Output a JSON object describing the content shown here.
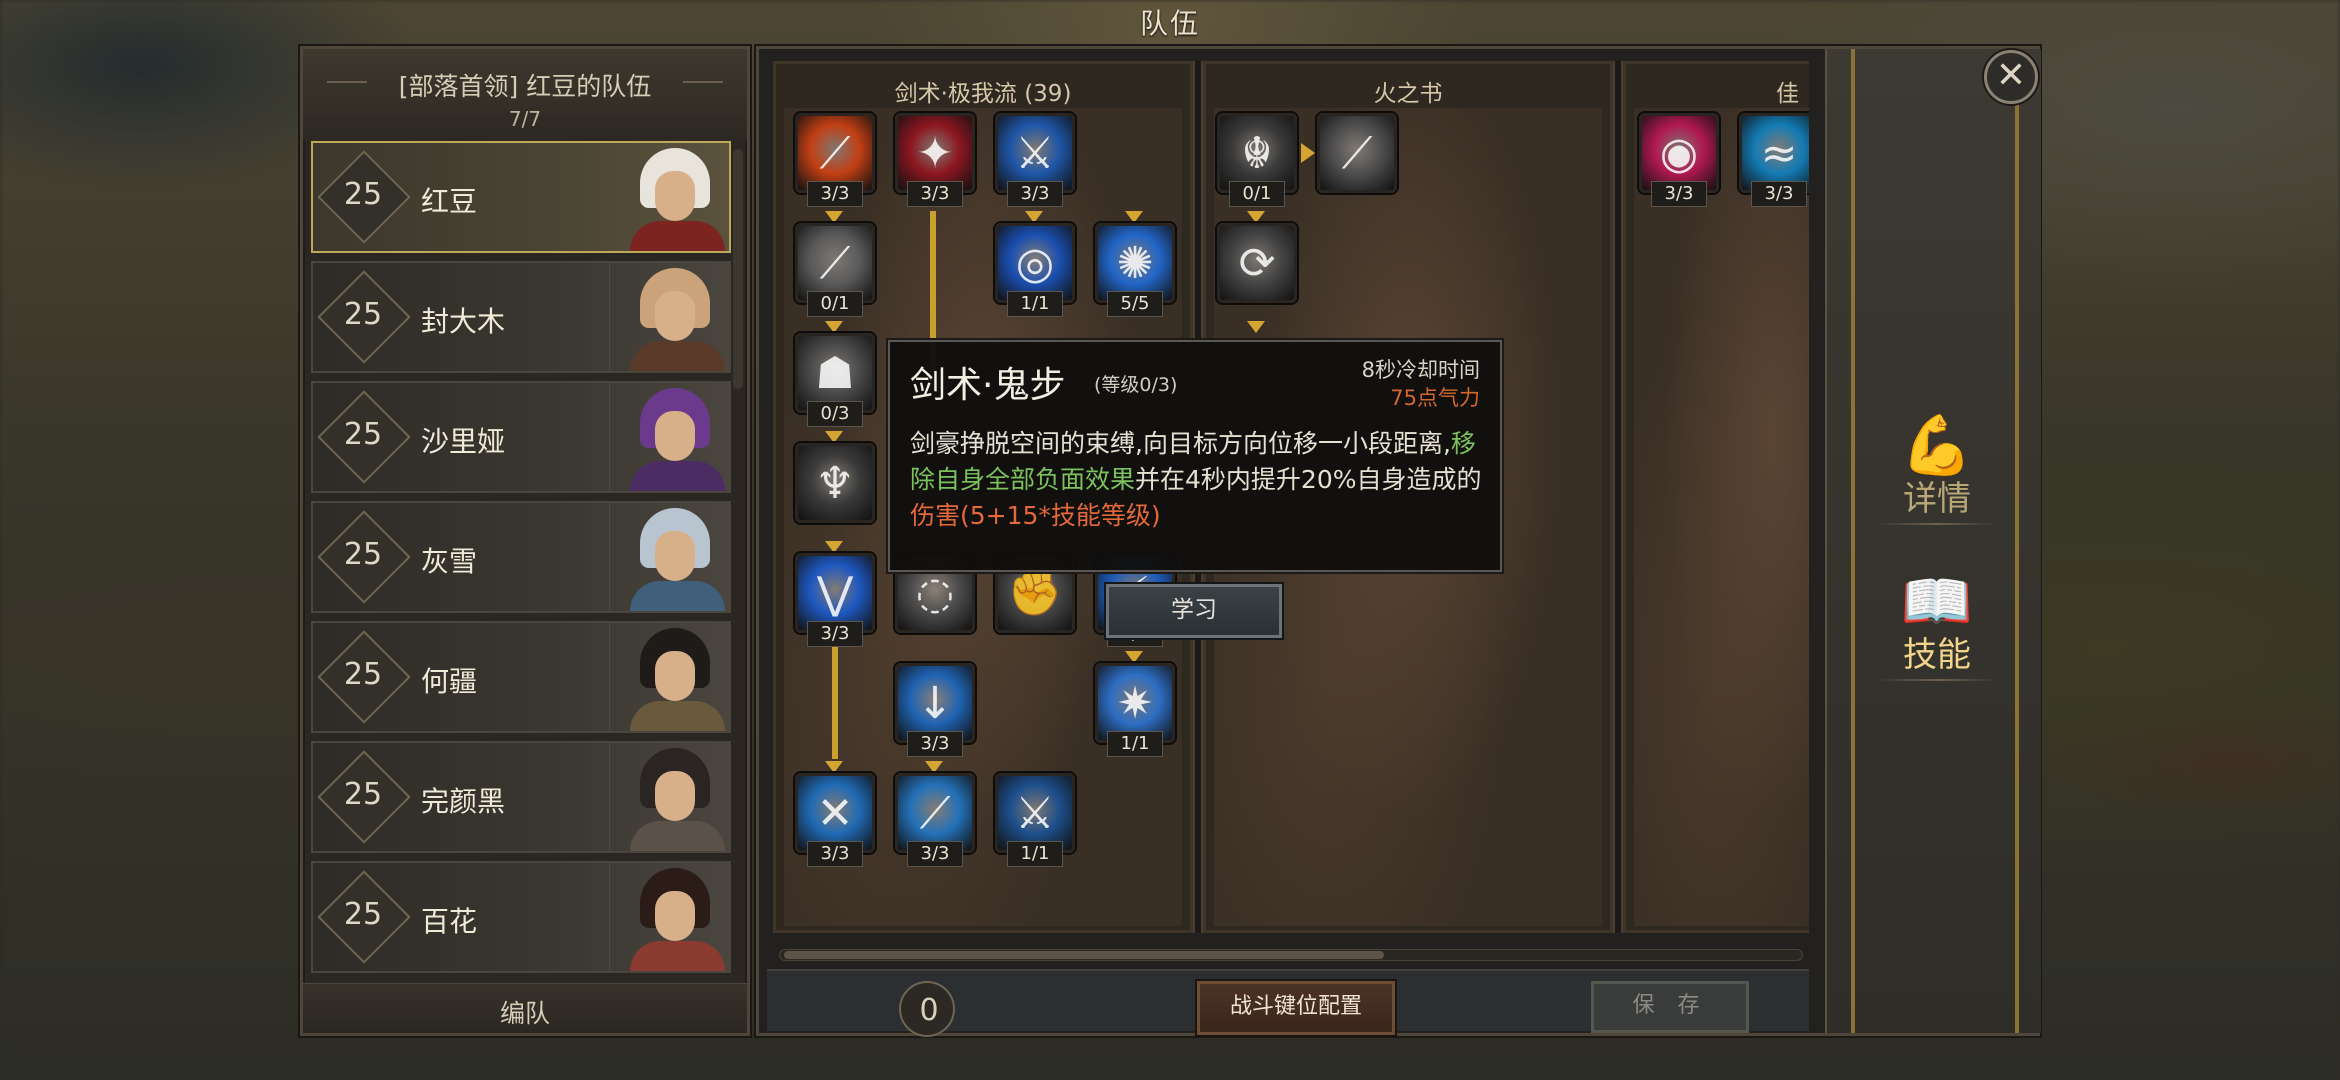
{
  "header": {
    "title": "队伍"
  },
  "team": {
    "title": "[部落首领] 红豆的队伍",
    "count": "7/7",
    "members": [
      {
        "level": "25",
        "name": "红豆",
        "selected": true,
        "hair": "#e8e4dc",
        "body": "#7b2420"
      },
      {
        "level": "25",
        "name": "封大木",
        "selected": false,
        "hair": "#caa37a",
        "body": "#5a3b2a"
      },
      {
        "level": "25",
        "name": "沙里娅",
        "selected": false,
        "hair": "#6b3a8c",
        "body": "#4b2d63"
      },
      {
        "level": "25",
        "name": "灰雪",
        "selected": false,
        "hair": "#b8c4cf",
        "body": "#3f5f7a"
      },
      {
        "level": "25",
        "name": "何疆",
        "selected": false,
        "hair": "#1f1b18",
        "body": "#6a5a3c"
      },
      {
        "level": "25",
        "name": "完颜黑",
        "selected": false,
        "hair": "#2a2522",
        "body": "#5a5248"
      },
      {
        "level": "25",
        "name": "百花",
        "selected": false,
        "hair": "#2b1c18",
        "body": "#8a3a2e"
      }
    ],
    "footer_label": "编队"
  },
  "skill_tree": {
    "columns": [
      {
        "title": "剑术·极我流 (39)"
      },
      {
        "title": "火之书"
      },
      {
        "title": "佳"
      }
    ],
    "skills": [
      {
        "name": "skill-fire-slash",
        "count": "3/3",
        "color": "#c23f14",
        "glyph": "⟋"
      },
      {
        "name": "skill-crimson-strike",
        "count": "3/3",
        "color": "#8c1620",
        "glyph": "✦"
      },
      {
        "name": "skill-ice-blade",
        "count": "3/3",
        "color": "#1f56a8",
        "glyph": "⚔"
      },
      {
        "name": "skill-silver-slash",
        "count": "0/1",
        "color": "#5a5a5a",
        "glyph": "⟋"
      },
      {
        "name": "skill-blue-vortex",
        "count": "1/1",
        "color": "#1a4fb0",
        "glyph": "◎"
      },
      {
        "name": "skill-blue-orb",
        "count": "5/5",
        "color": "#2266c8",
        "glyph": "✺"
      },
      {
        "name": "skill-ghost-step",
        "count": "0/3",
        "color": "#4a4a4a",
        "glyph": "☗"
      },
      {
        "name": "skill-demon-mask",
        "count": "",
        "color": "#3a3a3a",
        "glyph": "♆"
      },
      {
        "name": "skill-blue-chevron",
        "count": "3/3",
        "color": "#1e58c0",
        "glyph": "⋁"
      },
      {
        "name": "skill-grey-swirl",
        "count": "",
        "color": "#4a4a4a",
        "glyph": "◌"
      },
      {
        "name": "skill-grey-fist",
        "count": "",
        "color": "#454545",
        "glyph": "✊"
      },
      {
        "name": "skill-blue-blade-3",
        "count": "3/3",
        "color": "#1e5cb8",
        "glyph": "⚡"
      },
      {
        "name": "skill-sword-rain",
        "count": "3/3",
        "color": "#1f63b3",
        "glyph": "↓"
      },
      {
        "name": "skill-light-burst",
        "count": "1/1",
        "color": "#2d6ec4",
        "glyph": "✷"
      },
      {
        "name": "skill-cross-slash",
        "count": "3/3",
        "color": "#1f6ab5",
        "glyph": "✕"
      },
      {
        "name": "skill-spear-thrust",
        "count": "3/3",
        "color": "#2371b8",
        "glyph": "⟋"
      },
      {
        "name": "skill-twin-swords",
        "count": "1/1",
        "color": "#1d4f8c",
        "glyph": "⚔"
      },
      {
        "name": "skill-dragon-emblem",
        "count": "0/1",
        "color": "#3a3a3a",
        "glyph": "☬"
      },
      {
        "name": "skill-grey-blade",
        "count": "",
        "color": "#4e4e4e",
        "glyph": "⟋"
      },
      {
        "name": "skill-grey-hook",
        "count": "",
        "color": "#444444",
        "glyph": "⟳"
      },
      {
        "name": "skill-pink-vortex",
        "count": "3/3",
        "color": "#b01850",
        "glyph": "◉"
      },
      {
        "name": "skill-aqua-wave",
        "count": "3/3",
        "color": "#137bb4",
        "glyph": "≈"
      }
    ]
  },
  "tooltip": {
    "name": "剑术·鬼步",
    "level": "(等级0/3)",
    "cooldown": "8秒冷却时间",
    "cost": "75点气力",
    "desc_1": "剑豪挣脱空间的束缚,向目标方向位移一小段距离,",
    "desc_green": "移除自身全部负面效果",
    "desc_2": "并在4秒内提升20%自身造成的",
    "desc_red": "伤害(5+15*技能等级)",
    "learn_button": "学习"
  },
  "bottom": {
    "points": "0",
    "keybind_button": "战斗键位配置",
    "save_button": "保 存"
  },
  "side_tabs": [
    {
      "label": "详情",
      "icon": "arm-flex-icon",
      "active": false
    },
    {
      "label": "技能",
      "icon": "book-flame-icon",
      "active": true
    }
  ],
  "close_glyph": "✕"
}
